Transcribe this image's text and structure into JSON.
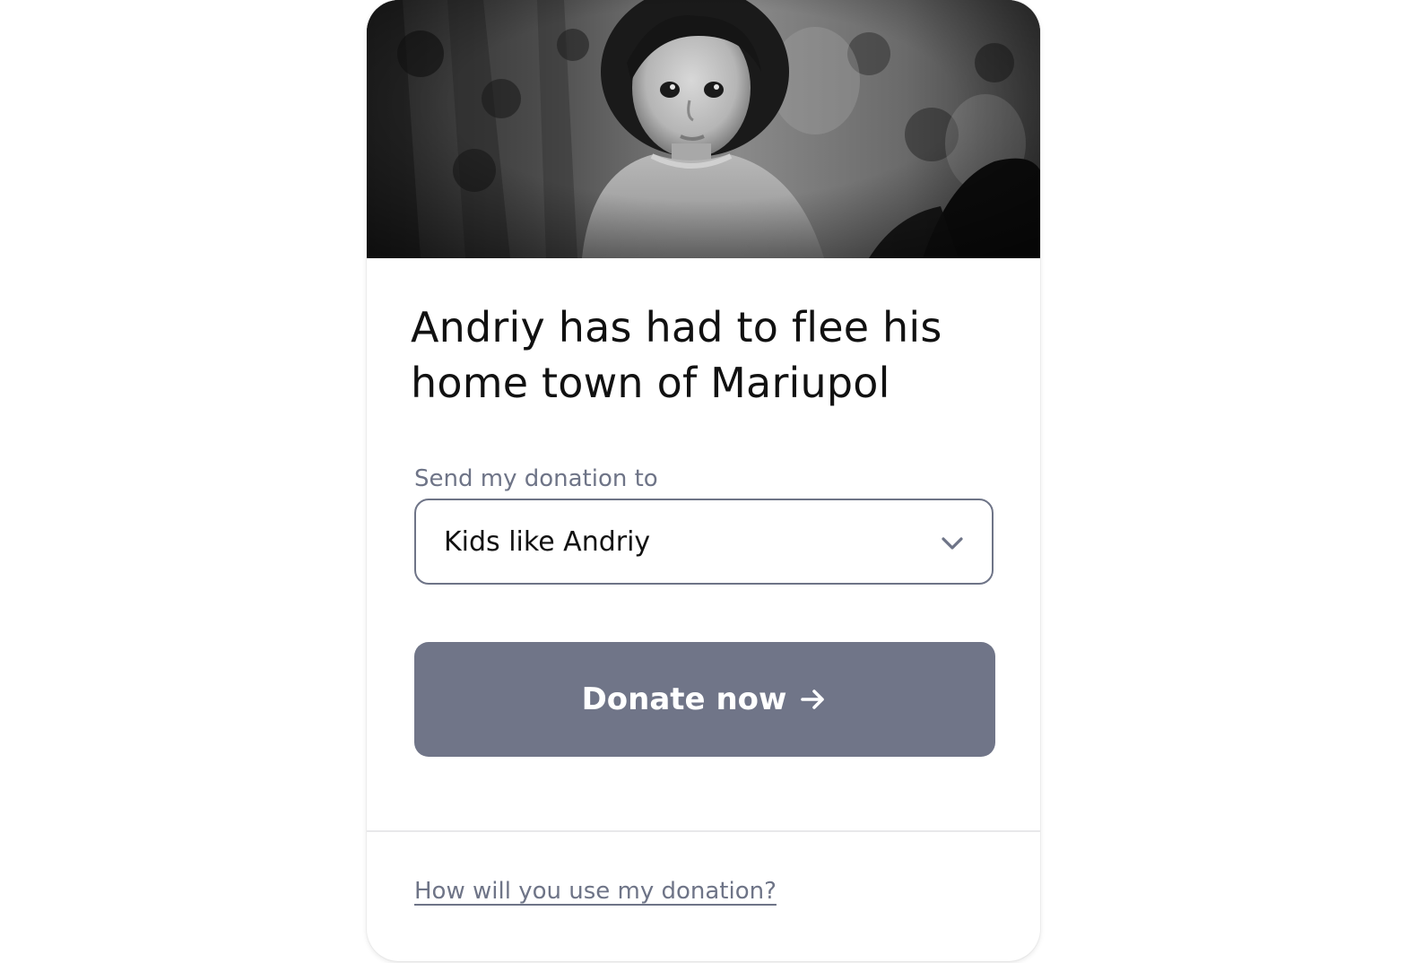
{
  "card": {
    "headline": "Andriy has had to flee his home town of Mariupol",
    "hero_image": "photo-child-portrait-black-and-white",
    "donation_select": {
      "label": "Send my donation to",
      "selected": "Kids like Andriy",
      "icon": "chevron-down-icon"
    },
    "donate_button": {
      "label": "Donate now",
      "icon": "arrow-right-icon"
    },
    "info_link": "How will you use my donation?"
  },
  "colors": {
    "button": "#707588",
    "muted_text": "#6e7487",
    "heading_text": "#111111",
    "divider": "#e8e8ea",
    "background": "#ffffff"
  }
}
